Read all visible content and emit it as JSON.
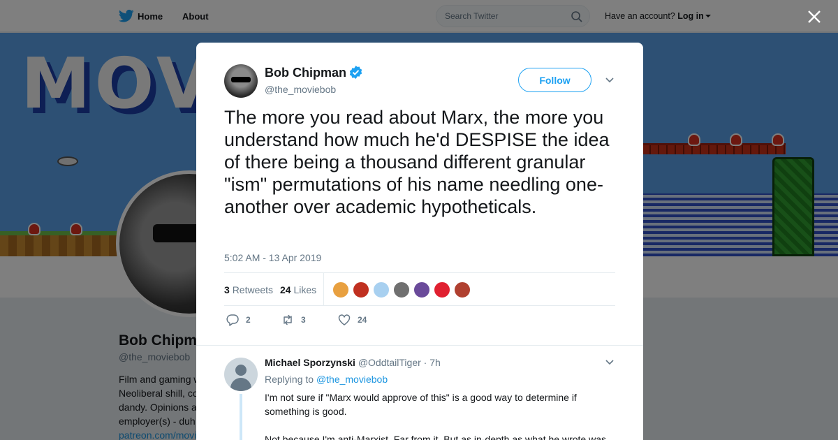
{
  "nav": {
    "home_label": "Home",
    "about_label": "About",
    "search_placeholder": "Search Twitter",
    "account_prompt": "Have an account?",
    "login_label": "Log in"
  },
  "banner": {
    "text": "MOVI"
  },
  "profile": {
    "name": "Bob Chipman",
    "handle": "@the_moviebob",
    "bio_lines": [
      "Film and gaming w",
      "Neoliberal shill, co",
      "dandy. Opinions a",
      "employer(s) - duh"
    ],
    "link": "patreon.com/movi"
  },
  "tweet": {
    "author_name": "Bob Chipman",
    "author_handle": "@the_moviebob",
    "follow_label": "Follow",
    "text": "The more you read about Marx, the more you understand how much he'd DESPISE the idea of there being a thousand different granular \"ism\" permutations of his name needling one-another over academic hypotheticals.",
    "timestamp": "5:02 AM - 13 Apr 2019",
    "retweets_count": "3",
    "retweets_label": "Retweets",
    "likes_count": "24",
    "likes_label": "Likes",
    "likers": [
      {
        "color": "#e8a040"
      },
      {
        "color": "#c03020"
      },
      {
        "color": "#a8d0f0"
      },
      {
        "color": "#707070"
      },
      {
        "color": "#6a4a9a"
      },
      {
        "color": "#e02030"
      },
      {
        "color": "#b04030"
      }
    ],
    "actions": {
      "replies": "2",
      "retweets": "3",
      "likes": "24"
    }
  },
  "reply": {
    "author_name": "Michael Sporzynski",
    "author_handle": "@OddtailTiger",
    "time": "· 7h",
    "replying_prefix": "Replying to",
    "replying_to": "@the_moviebob",
    "paragraphs": [
      "I'm not sure if \"Marx would approve of this\" is a good way to determine if something is good.",
      "Not because I'm anti-Marxist. Far from it. But as in-depth as what he wrote was,"
    ]
  },
  "colors": {
    "accent": "#1da1f2",
    "link": "#1b95e0",
    "muted": "#657786"
  }
}
